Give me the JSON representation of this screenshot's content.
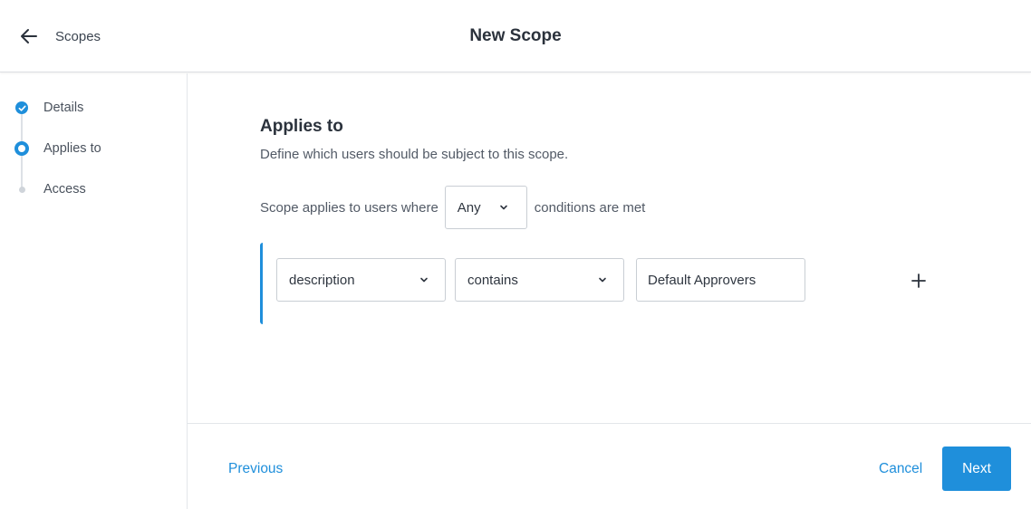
{
  "header": {
    "back_label": "Scopes",
    "title": "New Scope",
    "back_icon": "arrow-left-icon"
  },
  "steps": [
    {
      "label": "Details",
      "state": "completed",
      "icon": "check-circle-icon"
    },
    {
      "label": "Applies to",
      "state": "current",
      "icon": "ring-icon"
    },
    {
      "label": "Access",
      "state": "pending",
      "icon": "dot-icon"
    }
  ],
  "main": {
    "title": "Applies to",
    "description": "Define which users should be subject to this scope.",
    "rule_prefix": "Scope applies to users where",
    "match_value": "Any",
    "rule_suffix": "conditions are met",
    "condition": {
      "field": "description",
      "operator": "contains",
      "value": "Default Approvers"
    },
    "add_icon": "plus-icon"
  },
  "footer": {
    "previous_label": "Previous",
    "cancel_label": "Cancel",
    "next_label": "Next"
  },
  "colors": {
    "accent": "#1f8fdb",
    "border": "#c9ced4",
    "text": "#333a45"
  }
}
